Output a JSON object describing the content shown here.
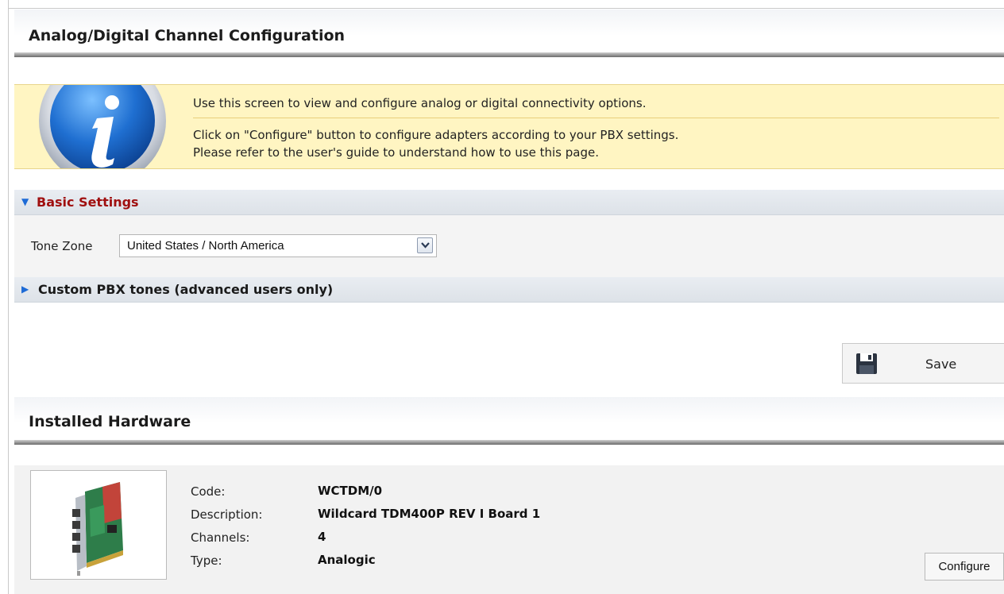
{
  "page": {
    "title": "Analog/Digital Channel Configuration"
  },
  "info": {
    "line1": "Use this screen to view and configure analog or digital connectivity options.",
    "line2": "Click on \"Configure\" button to configure adapters according to your PBX settings.",
    "line3": "Please refer to the user's guide to understand how to use this page.",
    "icon": "info-icon"
  },
  "basic_settings": {
    "header": "Basic Settings",
    "tone_zone_label": "Tone Zone",
    "tone_zone_value": "United States / North America"
  },
  "custom_tones": {
    "header": "Custom PBX tones (advanced users only)"
  },
  "save": {
    "label": "Save",
    "icon": "floppy-disk-icon"
  },
  "hardware": {
    "title": "Installed Hardware",
    "labels": {
      "code": "Code:",
      "description": "Description:",
      "channels": "Channels:",
      "type": "Type:"
    },
    "item": {
      "code": "WCTDM/0",
      "description": "Wildcard TDM400P REV I Board 1",
      "channels": "4",
      "type": "Analogic"
    },
    "configure_label": "Configure"
  },
  "colors": {
    "info_background": "#fff5c2",
    "section_accent": "#a01010",
    "expander_arrow": "#1e6bd6"
  }
}
